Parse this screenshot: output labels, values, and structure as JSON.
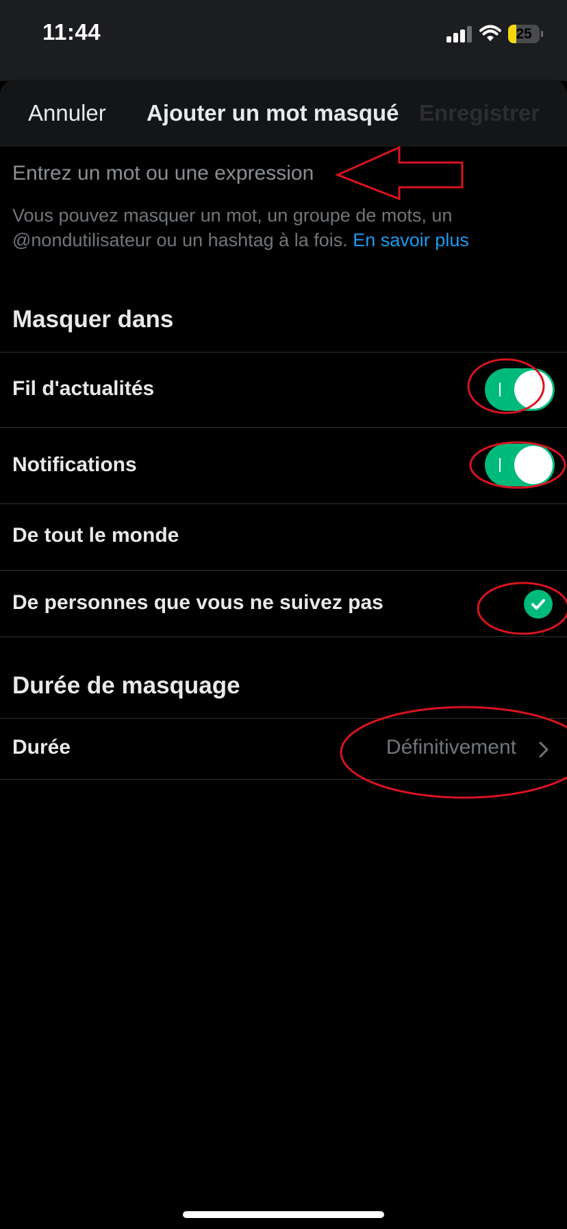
{
  "status_bar": {
    "time": "11:44",
    "battery_level": "25",
    "battery_fraction": 0.25,
    "battery_color": "#f5d90a",
    "icons": [
      "signal-icon",
      "wifi-icon",
      "battery-icon"
    ]
  },
  "header": {
    "cancel_label": "Annuler",
    "title": "Ajouter un mot masqué",
    "save_label": "Enregistrer"
  },
  "input": {
    "placeholder": "Entrez un mot ou une expression",
    "value": ""
  },
  "help": {
    "text": "Vous pouvez masquer un mot, un groupe de mots, un @nondutilisateur ou un hashtag à la fois.",
    "link_label": "En savoir plus"
  },
  "mute_in": {
    "heading": "Masquer dans",
    "rows": [
      {
        "label": "Fil d'actualités",
        "control": "toggle",
        "on": true
      },
      {
        "label": "Notifications",
        "control": "toggle",
        "on": true
      },
      {
        "label": "De tout le monde",
        "control": "radio",
        "selected": false
      },
      {
        "label": "De personnes que vous ne suivez pas",
        "control": "radio",
        "selected": true
      }
    ]
  },
  "mute_duration": {
    "heading": "Durée de masquage",
    "row_label": "Durée",
    "value": "Définitivement"
  },
  "colors": {
    "accent": "#00ba7c",
    "link": "#1d9bf0",
    "annotation": "#d9141f",
    "background": "#000000"
  }
}
